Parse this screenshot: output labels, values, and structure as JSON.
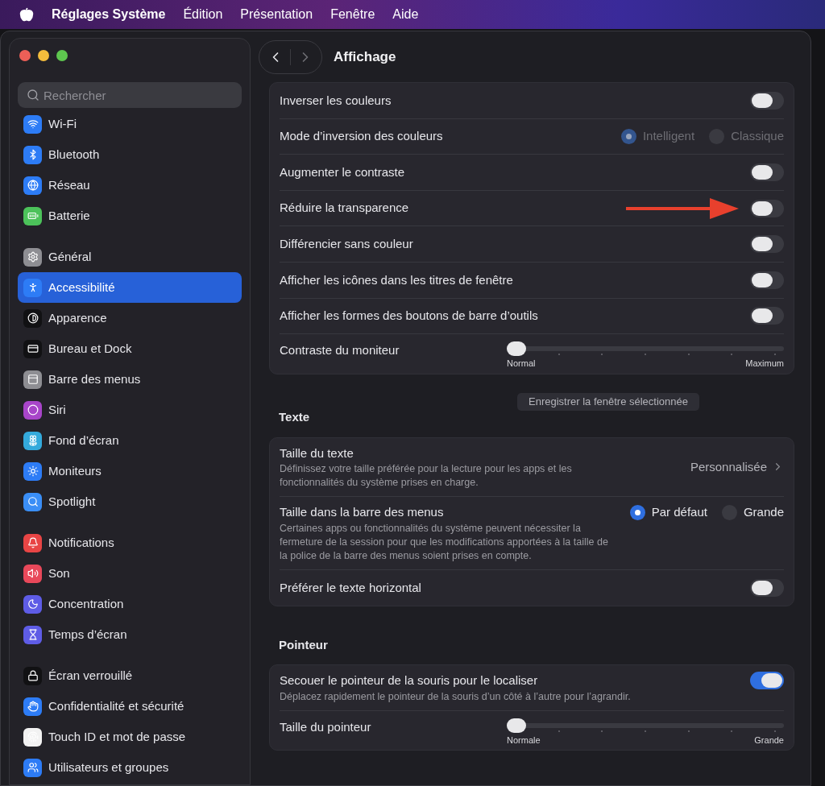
{
  "menu_bar": {
    "app_name": "Réglages Système",
    "items": [
      "Édition",
      "Présentation",
      "Fenêtre",
      "Aide"
    ]
  },
  "sidebar": {
    "search": {
      "placeholder": "Rechercher"
    },
    "groups": [
      {
        "items": [
          {
            "label": "Wi-Fi",
            "color": "#2d7cf6",
            "selected": false
          },
          {
            "label": "Bluetooth",
            "color": "#2d7cf6",
            "selected": false
          },
          {
            "label": "Réseau",
            "color": "#2d7cf6",
            "selected": false
          },
          {
            "label": "Batterie",
            "color": "#4cc25a",
            "selected": false
          }
        ]
      },
      {
        "items": [
          {
            "label": "Général",
            "color": "#8e8e93",
            "selected": false
          },
          {
            "label": "Accessibilité",
            "color": "#2d7cf6",
            "selected": true
          },
          {
            "label": "Apparence",
            "color": "#111113",
            "selected": false
          },
          {
            "label": "Bureau et Dock",
            "color": "#111113",
            "selected": false
          },
          {
            "label": "Barre des menus",
            "color": "#8e8e93",
            "selected": false
          },
          {
            "label": "Siri",
            "color": "#a845c9",
            "selected": false
          },
          {
            "label": "Fond d’écran",
            "color": "#34aadc",
            "selected": false
          },
          {
            "label": "Moniteurs",
            "color": "#2d7cf6",
            "selected": false
          },
          {
            "label": "Spotlight",
            "color": "#3a8ef6",
            "selected": false
          }
        ]
      },
      {
        "items": [
          {
            "label": "Notifications",
            "color": "#e84545",
            "selected": false
          },
          {
            "label": "Son",
            "color": "#e8485a",
            "selected": false
          },
          {
            "label": "Concentration",
            "color": "#5e5ce6",
            "selected": false
          },
          {
            "label": "Temps d’écran",
            "color": "#5e5ce6",
            "selected": false
          }
        ]
      },
      {
        "items": [
          {
            "label": "Écran verrouillé",
            "color": "#111113",
            "selected": false
          },
          {
            "label": "Confidentialité et sécurité",
            "color": "#2d7cf6",
            "selected": false
          },
          {
            "label": "Touch ID et mot de passe",
            "color": "#f2f2f2",
            "selected": false
          },
          {
            "label": "Utilisateurs et groupes",
            "color": "#2d7cf6",
            "selected": false
          }
        ]
      }
    ]
  },
  "content": {
    "title": "Affichage",
    "sections": [
      {
        "rows": [
          {
            "kind": "toggle",
            "label": "Inverser les couleurs",
            "on": false
          },
          {
            "kind": "radio",
            "label": "Mode d’inversion des couleurs",
            "disabled": true,
            "options": [
              {
                "label": "Intelligent",
                "selected": true
              },
              {
                "label": "Classique",
                "selected": false
              }
            ]
          },
          {
            "kind": "toggle",
            "label": "Augmenter le contraste",
            "on": false
          },
          {
            "kind": "toggle",
            "label": "Réduire la transparence",
            "on": false,
            "annotated": true
          },
          {
            "kind": "toggle",
            "label": "Différencier sans couleur",
            "on": false
          },
          {
            "kind": "toggle",
            "label": "Afficher les icônes dans les titres de fenêtre",
            "on": false
          },
          {
            "kind": "toggle",
            "label": "Afficher les formes des boutons de barre d’outils",
            "on": false
          },
          {
            "kind": "slider",
            "label": "Contraste du moniteur",
            "level": 0,
            "min_label": "Normal",
            "max_label": "Maximum"
          }
        ]
      },
      {
        "title": "Texte",
        "button": "Enregistrer la fenêtre sélectionnée",
        "rows": [
          {
            "kind": "link",
            "label": "Taille du texte",
            "description": "Définissez votre taille préférée pour la lecture pour les apps et les fonctionnalités du système prises en charge.",
            "value": "Personnalisée"
          },
          {
            "kind": "radio",
            "label": "Taille dans la barre des menus",
            "description": "Certaines apps ou fonctionnalités du système peuvent nécessiter la fermeture de la session pour que les modifications apportées à la taille de la police de la barre des menus soient prises en compte.",
            "disabled": false,
            "options": [
              {
                "label": "Par défaut",
                "selected": true
              },
              {
                "label": "Grande",
                "selected": false
              }
            ]
          },
          {
            "kind": "toggle",
            "label": "Préférer le texte horizontal",
            "on": false
          }
        ]
      },
      {
        "title": "Pointeur",
        "rows": [
          {
            "kind": "toggle",
            "label": "Secouer le pointeur de la souris pour le localiser",
            "description": "Déplacez rapidement le pointeur de la souris d’un côté à l’autre pour l’agrandir.",
            "on": true
          },
          {
            "kind": "slider",
            "label": "Taille du pointeur",
            "level": 0,
            "min_label": "Normale",
            "max_label": "Grande"
          }
        ]
      }
    ]
  }
}
